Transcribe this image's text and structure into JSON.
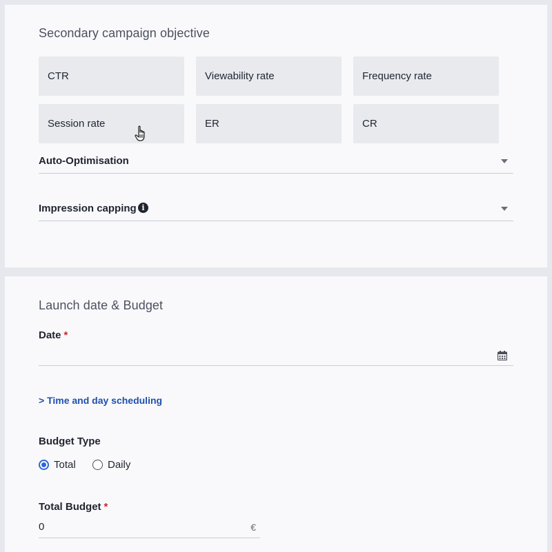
{
  "secondary_objective": {
    "title": "Secondary campaign objective",
    "options": [
      {
        "label": "CTR"
      },
      {
        "label": "Viewability rate"
      },
      {
        "label": "Frequency rate"
      },
      {
        "label": "Session rate"
      },
      {
        "label": "ER"
      },
      {
        "label": "CR"
      }
    ],
    "auto_optimisation": {
      "label": "Auto-Optimisation",
      "icon": "chevron-down-icon"
    },
    "impression_capping": {
      "label": "Impression capping",
      "info_icon": "i",
      "icon": "chevron-down-icon"
    }
  },
  "launch_budget": {
    "title": "Launch date & Budget",
    "date": {
      "label": "Date",
      "required_marker": "*",
      "value": "",
      "icon": "calendar-icon"
    },
    "scheduling_link": "> Time and day scheduling",
    "budget_type": {
      "label": "Budget Type",
      "options": [
        {
          "label": "Total",
          "selected": true
        },
        {
          "label": "Daily",
          "selected": false
        }
      ]
    },
    "total_budget": {
      "label": "Total Budget",
      "required_marker": "*",
      "value": "0",
      "currency": "€"
    }
  },
  "colors": {
    "accent_blue": "#2b67d6",
    "link_blue": "#1f4fae",
    "required_red": "#d0202e",
    "tile_background": "#e8eaee",
    "page_background": "#e6e8ee"
  }
}
